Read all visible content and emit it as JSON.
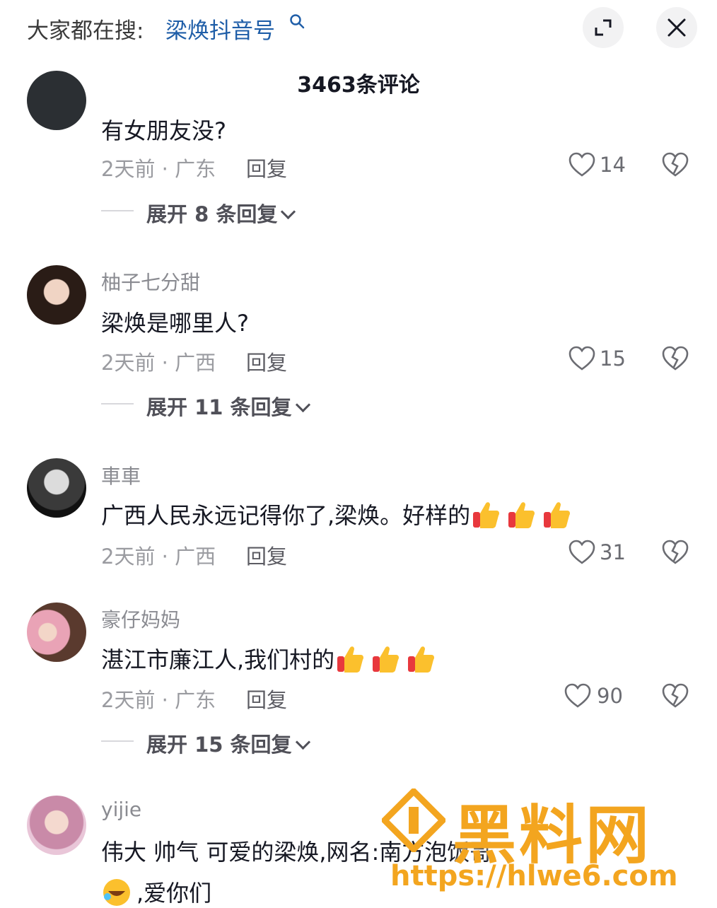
{
  "search": {
    "prefix": "大家都在搜:",
    "query": "梁焕抖音号"
  },
  "header": {
    "comment_count": "3463条评论"
  },
  "comments": [
    {
      "username": "",
      "text": "有女朋友没?",
      "time_location": "2天前 · 广东",
      "reply_label": "回复",
      "likes": "14",
      "expand": "展开 8 条回复"
    },
    {
      "username": "柚子七分甜",
      "text": "梁焕是哪里人?",
      "time_location": "2天前 · 广西",
      "reply_label": "回复",
      "likes": "15",
      "expand": "展开 11 条回复"
    },
    {
      "username": "車車",
      "text": "广西人民永远记得你了,梁焕。好样的",
      "time_location": "2天前 · 广西",
      "reply_label": "回复",
      "likes": "31",
      "expand": ""
    },
    {
      "username": "豪仔妈妈",
      "text": "湛江市廉江人,我们村的",
      "time_location": "2天前 · 广东",
      "reply_label": "回复",
      "likes": "90",
      "expand": "展开 15 条回复"
    },
    {
      "username": "yijie",
      "text_line1": "伟大  帅气  可爱的梁焕,网名:南方泡饭哥",
      "text_line2": ",爱你们"
    }
  ],
  "watermark": {
    "brand": "黑料网",
    "url": "https://hlwe6.com"
  },
  "icons": {
    "like": "heart-outline-icon",
    "dislike": "broken-heart-icon",
    "expand": "expand-icon",
    "close": "close-icon"
  },
  "colors": {
    "link": "#1f5ea8",
    "watermark": "#f3a51f",
    "secondary_text": "#9a9ba0"
  }
}
